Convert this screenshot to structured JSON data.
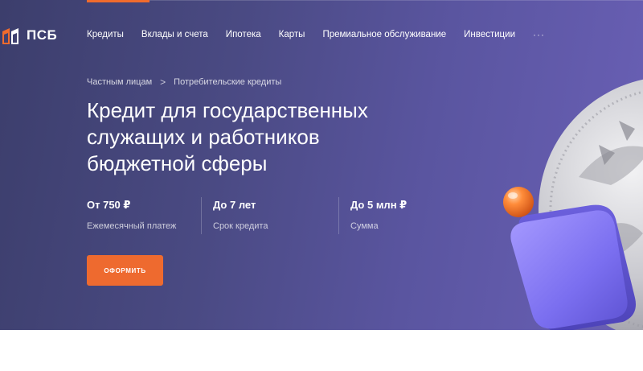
{
  "brand": {
    "name": "ПСБ",
    "accent_color": "#f06b2d",
    "logo_icon": "psb-logo-icon"
  },
  "nav": {
    "items": [
      {
        "label": "Кредиты"
      },
      {
        "label": "Вклады и счета"
      },
      {
        "label": "Ипотека"
      },
      {
        "label": "Карты"
      },
      {
        "label": "Премиальное обслуживание"
      },
      {
        "label": "Инвестиции"
      }
    ],
    "more_label": "···"
  },
  "breadcrumb": {
    "items": [
      "Частным лицам",
      "Потребительские кредиты"
    ],
    "separator": ">"
  },
  "hero": {
    "title_lines": [
      "Кредит для государственных",
      "служащих и работников",
      "бюджетной сферы"
    ],
    "stats": [
      {
        "value": "От 750 ₽",
        "label": "Ежемесячный платеж"
      },
      {
        "value": "До 7 лет",
        "label": "Срок кредита"
      },
      {
        "value": "До 5 млн ₽",
        "label": "Сумма"
      }
    ],
    "cta_label": "ОФОРМИТЬ",
    "cta_color": "#ee6a2f"
  }
}
